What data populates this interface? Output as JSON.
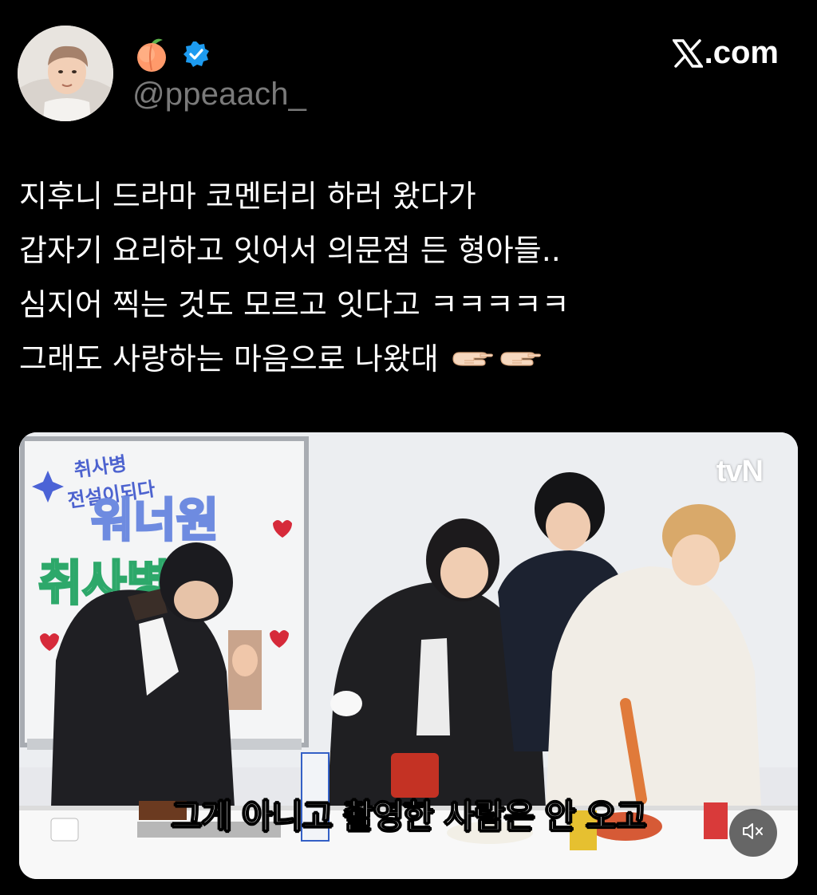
{
  "author": {
    "handle": "@ppeaach_",
    "display_name_icon": "peach-emoji-icon",
    "verified_icon": "verified-badge-icon"
  },
  "brand": {
    "site": ".com",
    "logo_icon": "x-logo-icon"
  },
  "tweet": {
    "lines": [
      "지후니 드라마 코멘터리 하러 왔다가",
      "갑자기 요리하고 잇어서 의문점 든 형아들..",
      "심지어 찍는 것도 모르고 잇다고 ㅋㅋㅋㅋㅋ",
      "그래도 사랑하는 마음으로 나왔대"
    ],
    "trailing_icons": [
      "pointing-hand-icon",
      "pointing-hand-icon"
    ]
  },
  "media": {
    "broadcaster": "tvN",
    "subtitle": "그게 아니고 촬영한 사람은 안 오고",
    "whiteboard_text": [
      "취사병",
      "전설이되다",
      "워너원",
      "취사병이"
    ],
    "mute_icon": "speaker-muted-icon"
  },
  "colors": {
    "background": "#000000",
    "handle": "#7a7a7a",
    "verified": "#1d9bf0",
    "peach": "#ff9a6b"
  }
}
